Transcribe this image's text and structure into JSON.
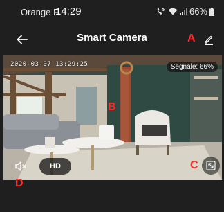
{
  "status_bar": {
    "carrier": "Orange F",
    "time": "14:29",
    "battery_percent": "66%",
    "icons": [
      "wifi-calling-icon",
      "wifi-icon",
      "signal-icon",
      "battery-icon"
    ]
  },
  "header": {
    "title": "Smart Camera",
    "back_icon": "arrow-left-icon",
    "edit_icon": "pencil-icon"
  },
  "video": {
    "timestamp": "2020-03-07 13:29:25",
    "signal_label": "Segnale: 66%",
    "hd_label": "HD",
    "mute_icon": "speaker-muted-icon",
    "fullscreen_icon": "fullscreen-icon"
  },
  "annotations": {
    "a": "A",
    "b": "B",
    "c": "C",
    "d": "D",
    "color": "#ff2a2a"
  },
  "colors": {
    "background": "#1f1f1f",
    "text": "#ffffff"
  }
}
